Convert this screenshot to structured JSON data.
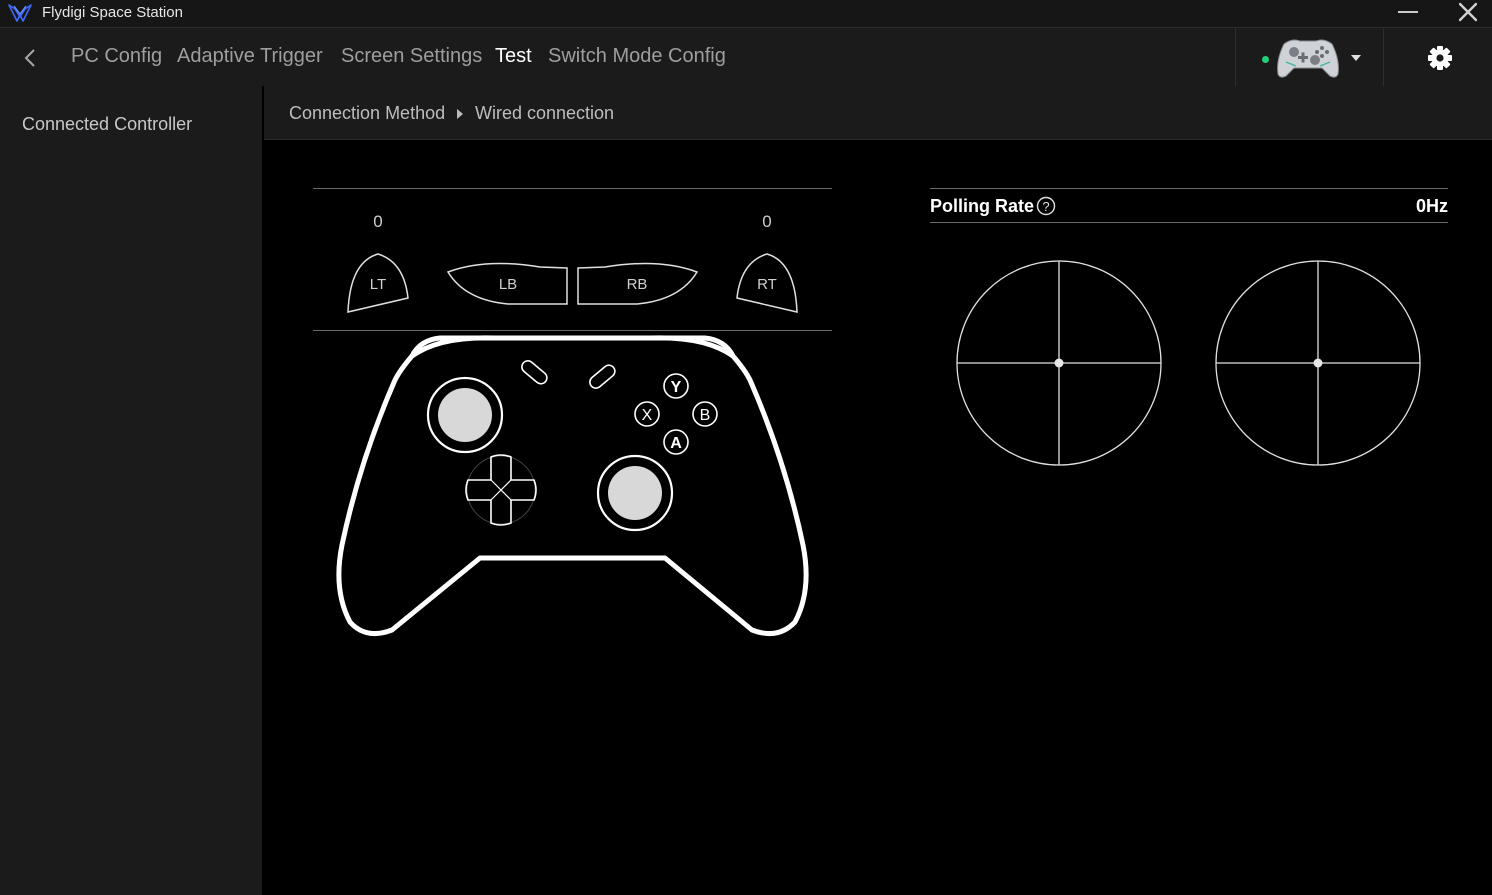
{
  "app": {
    "title": "Flydigi Space Station"
  },
  "nav": {
    "tabs": [
      {
        "label": "PC Config"
      },
      {
        "label": "Adaptive Trigger"
      },
      {
        "label": "Screen Settings"
      },
      {
        "label": "Test",
        "active": true
      },
      {
        "label": "Switch Mode Config"
      }
    ],
    "connection_status_color": "#22d07a"
  },
  "sidebar": {
    "items": [
      {
        "label": "Connected Controller"
      }
    ]
  },
  "breadcrumb": {
    "method_label": "Connection Method",
    "method_value": "Wired connection"
  },
  "test": {
    "triggers": {
      "left_value": "0",
      "right_value": "0",
      "lt_label": "LT",
      "lb_label": "LB",
      "rb_label": "RB",
      "rt_label": "RT"
    },
    "face_buttons": {
      "y": "Y",
      "x": "X",
      "b": "B",
      "a": "A"
    },
    "polling": {
      "label": "Polling Rate",
      "help": "?",
      "value": "0Hz"
    }
  },
  "icons": {
    "app_logo": "flydigi-logo-icon",
    "back": "chevron-left-icon",
    "minimize": "minimize-icon",
    "close": "close-icon",
    "settings": "gear-icon",
    "device_dropdown": "caret-down-icon",
    "breadcrumb_separator": "triangle-right-icon"
  }
}
